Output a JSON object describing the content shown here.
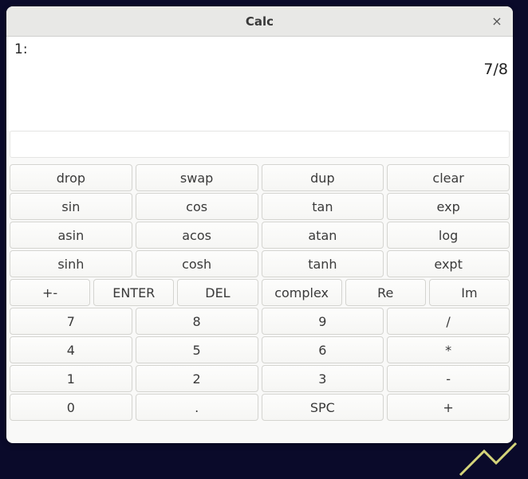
{
  "window": {
    "title": "Calc",
    "close_glyph": "×"
  },
  "display": {
    "stack_index": "1:",
    "stack_value": "7/8",
    "input_value": ""
  },
  "buttons": {
    "row1": [
      "drop",
      "swap",
      "dup",
      "clear"
    ],
    "row2": [
      "sin",
      "cos",
      "tan",
      "exp"
    ],
    "row3": [
      "asin",
      "acos",
      "atan",
      "log"
    ],
    "row4": [
      "sinh",
      "cosh",
      "tanh",
      "expt"
    ],
    "row5": [
      "+-",
      "ENTER",
      "DEL",
      "complex",
      "Re",
      "Im"
    ],
    "row6": [
      "7",
      "8",
      "9",
      "/"
    ],
    "row7": [
      "4",
      "5",
      "6",
      "*"
    ],
    "row8": [
      "1",
      "2",
      "3",
      "-"
    ],
    "row9": [
      "0",
      ".",
      "SPC",
      "+"
    ]
  }
}
